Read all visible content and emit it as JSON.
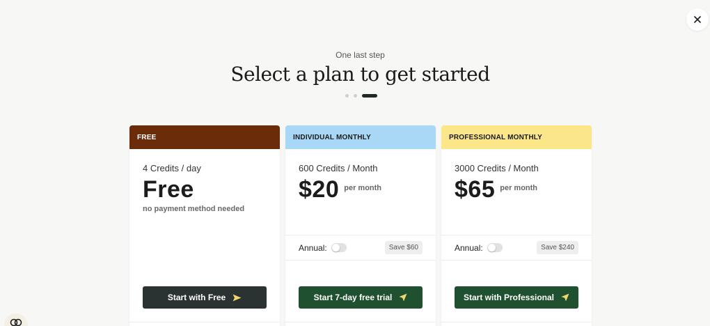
{
  "header": {
    "subtitle": "One last step",
    "title": "Select a plan to get started"
  },
  "stepper": {
    "total_steps": 3,
    "current_step": 3
  },
  "plans": [
    {
      "header_label": "FREE",
      "header_color": "#6b2c0a",
      "header_text_color": "#ffffff",
      "credits": "4 Credits / day",
      "price": "Free",
      "note": "no payment method needed",
      "cta_label": "Start with Free",
      "cta_color": "#2b3332",
      "cta_icon": "send-icon",
      "cta_icon_color": "#f2d56b"
    },
    {
      "header_label": "INDIVIDUAL MONTHLY",
      "header_color": "#a9d8f6",
      "header_text_color": "#1a1a1a",
      "credits": "600 Credits / Month",
      "price": "$20",
      "per": "per month",
      "annual_label": "Annual:",
      "annual_on": false,
      "save_label": "Save $60",
      "cta_label": "Start 7-day free trial",
      "cta_color": "#1f5130",
      "cta_icon": "navigation-arrow-icon",
      "cta_icon_color": "#f2d56b"
    },
    {
      "header_label": "PROFESSIONAL MONTHLY",
      "header_color": "#fbe78a",
      "header_text_color": "#1a1a1a",
      "credits": "3000 Credits / Month",
      "price": "$65",
      "per": "per month",
      "annual_label": "Annual:",
      "annual_on": false,
      "save_label": "Save $240",
      "cta_label": "Start with Professional",
      "cta_color": "#1f5130",
      "cta_icon": "navigation-arrow-icon",
      "cta_icon_color": "#f2d56b"
    }
  ],
  "icons": {
    "close": "close-icon",
    "chat": "chat-bubble-icon"
  }
}
